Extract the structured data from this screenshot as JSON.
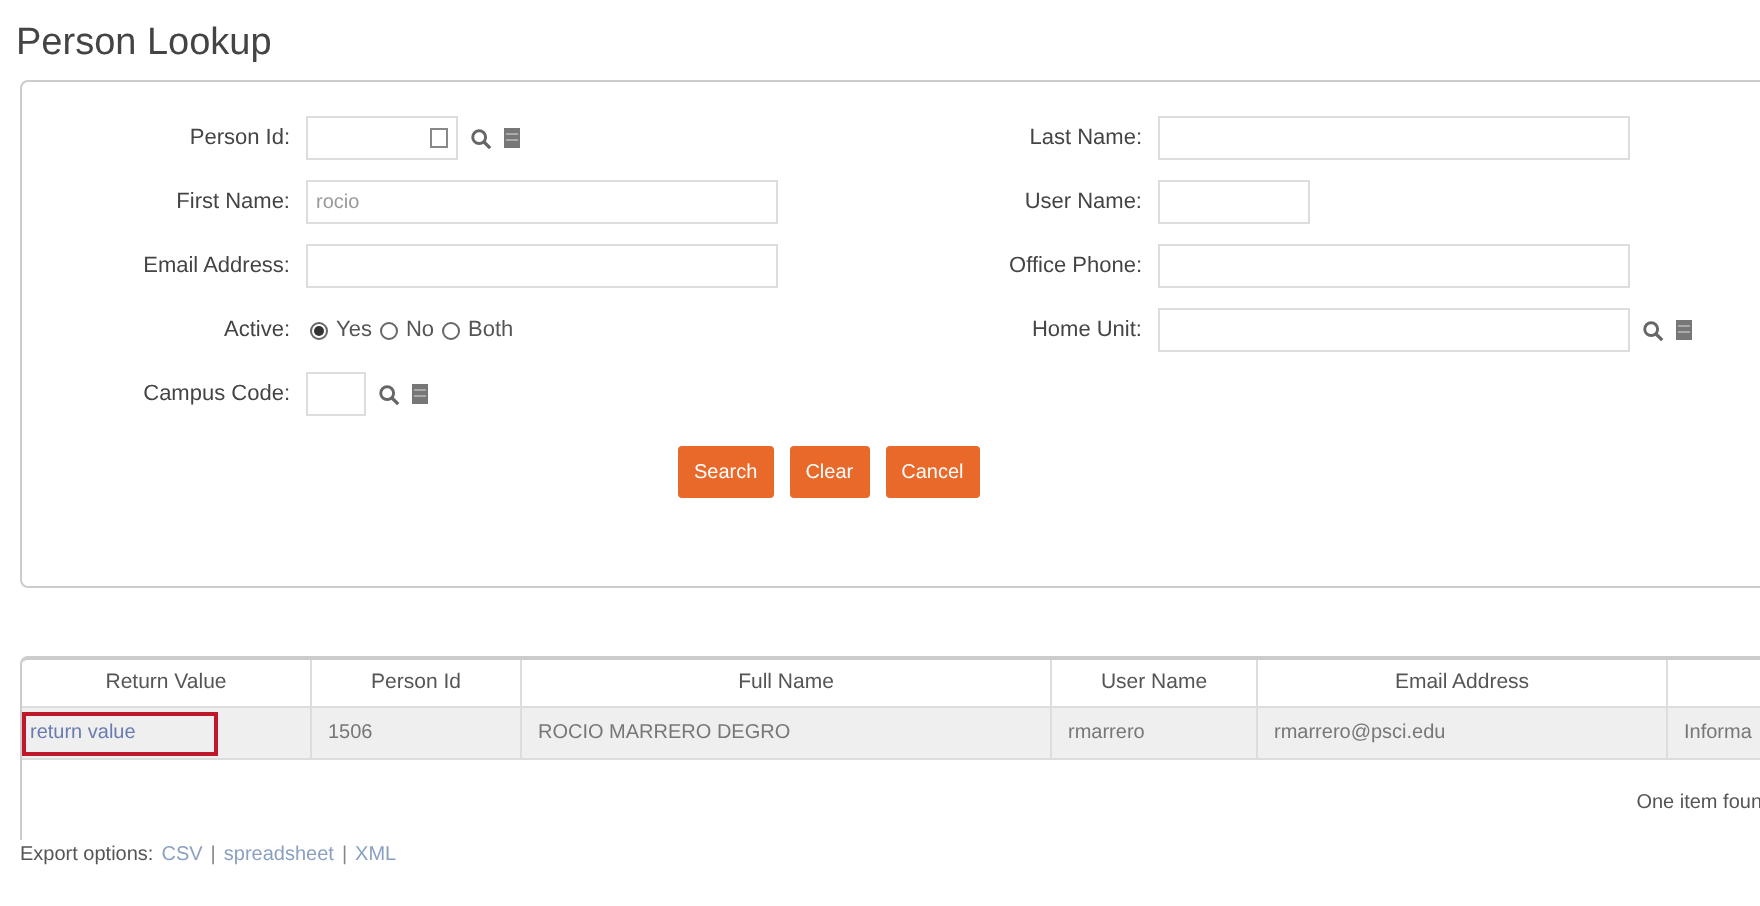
{
  "title": "Person Lookup",
  "left_fields": [
    {
      "label": "Person Id:",
      "kind": "lookup",
      "picker": true
    },
    {
      "label": "First Name:",
      "kind": "text",
      "value": "rocio"
    },
    {
      "label": "Email Address:",
      "kind": "text"
    },
    {
      "label": "Active:",
      "kind": "radio",
      "options": [
        {
          "label": "Yes",
          "selected": true
        },
        {
          "label": "No",
          "selected": false
        },
        {
          "label": "Both",
          "selected": false
        }
      ]
    },
    {
      "label": "Campus Code:",
      "kind": "lookup",
      "picker": false
    }
  ],
  "right_fields": [
    {
      "label": "Last Name:",
      "kind": "text"
    },
    {
      "label": "User Name:",
      "kind": "text"
    },
    {
      "label": "Office Phone:",
      "kind": "text"
    },
    {
      "label": "Home Unit:",
      "kind": "lookup",
      "picker": false
    }
  ],
  "buttons": [
    "Search",
    "Clear",
    "Cancel"
  ],
  "table": {
    "columns": [
      "Return Value",
      "Person Id",
      "Full Name",
      "User Name",
      "Email Address"
    ],
    "rows": [
      {
        "highlighted": true,
        "cells": [
          "return value",
          "1506",
          "ROCIO MARRERO DEGRO",
          "rmarrero",
          "rmarrero@psci.edu",
          "Informa"
        ]
      }
    ]
  },
  "result_count": "One item foun",
  "export": {
    "label": "Export options:",
    "links": [
      "CSV",
      "spreadsheet",
      "XML"
    ],
    "separators": [
      "|",
      "|"
    ]
  }
}
